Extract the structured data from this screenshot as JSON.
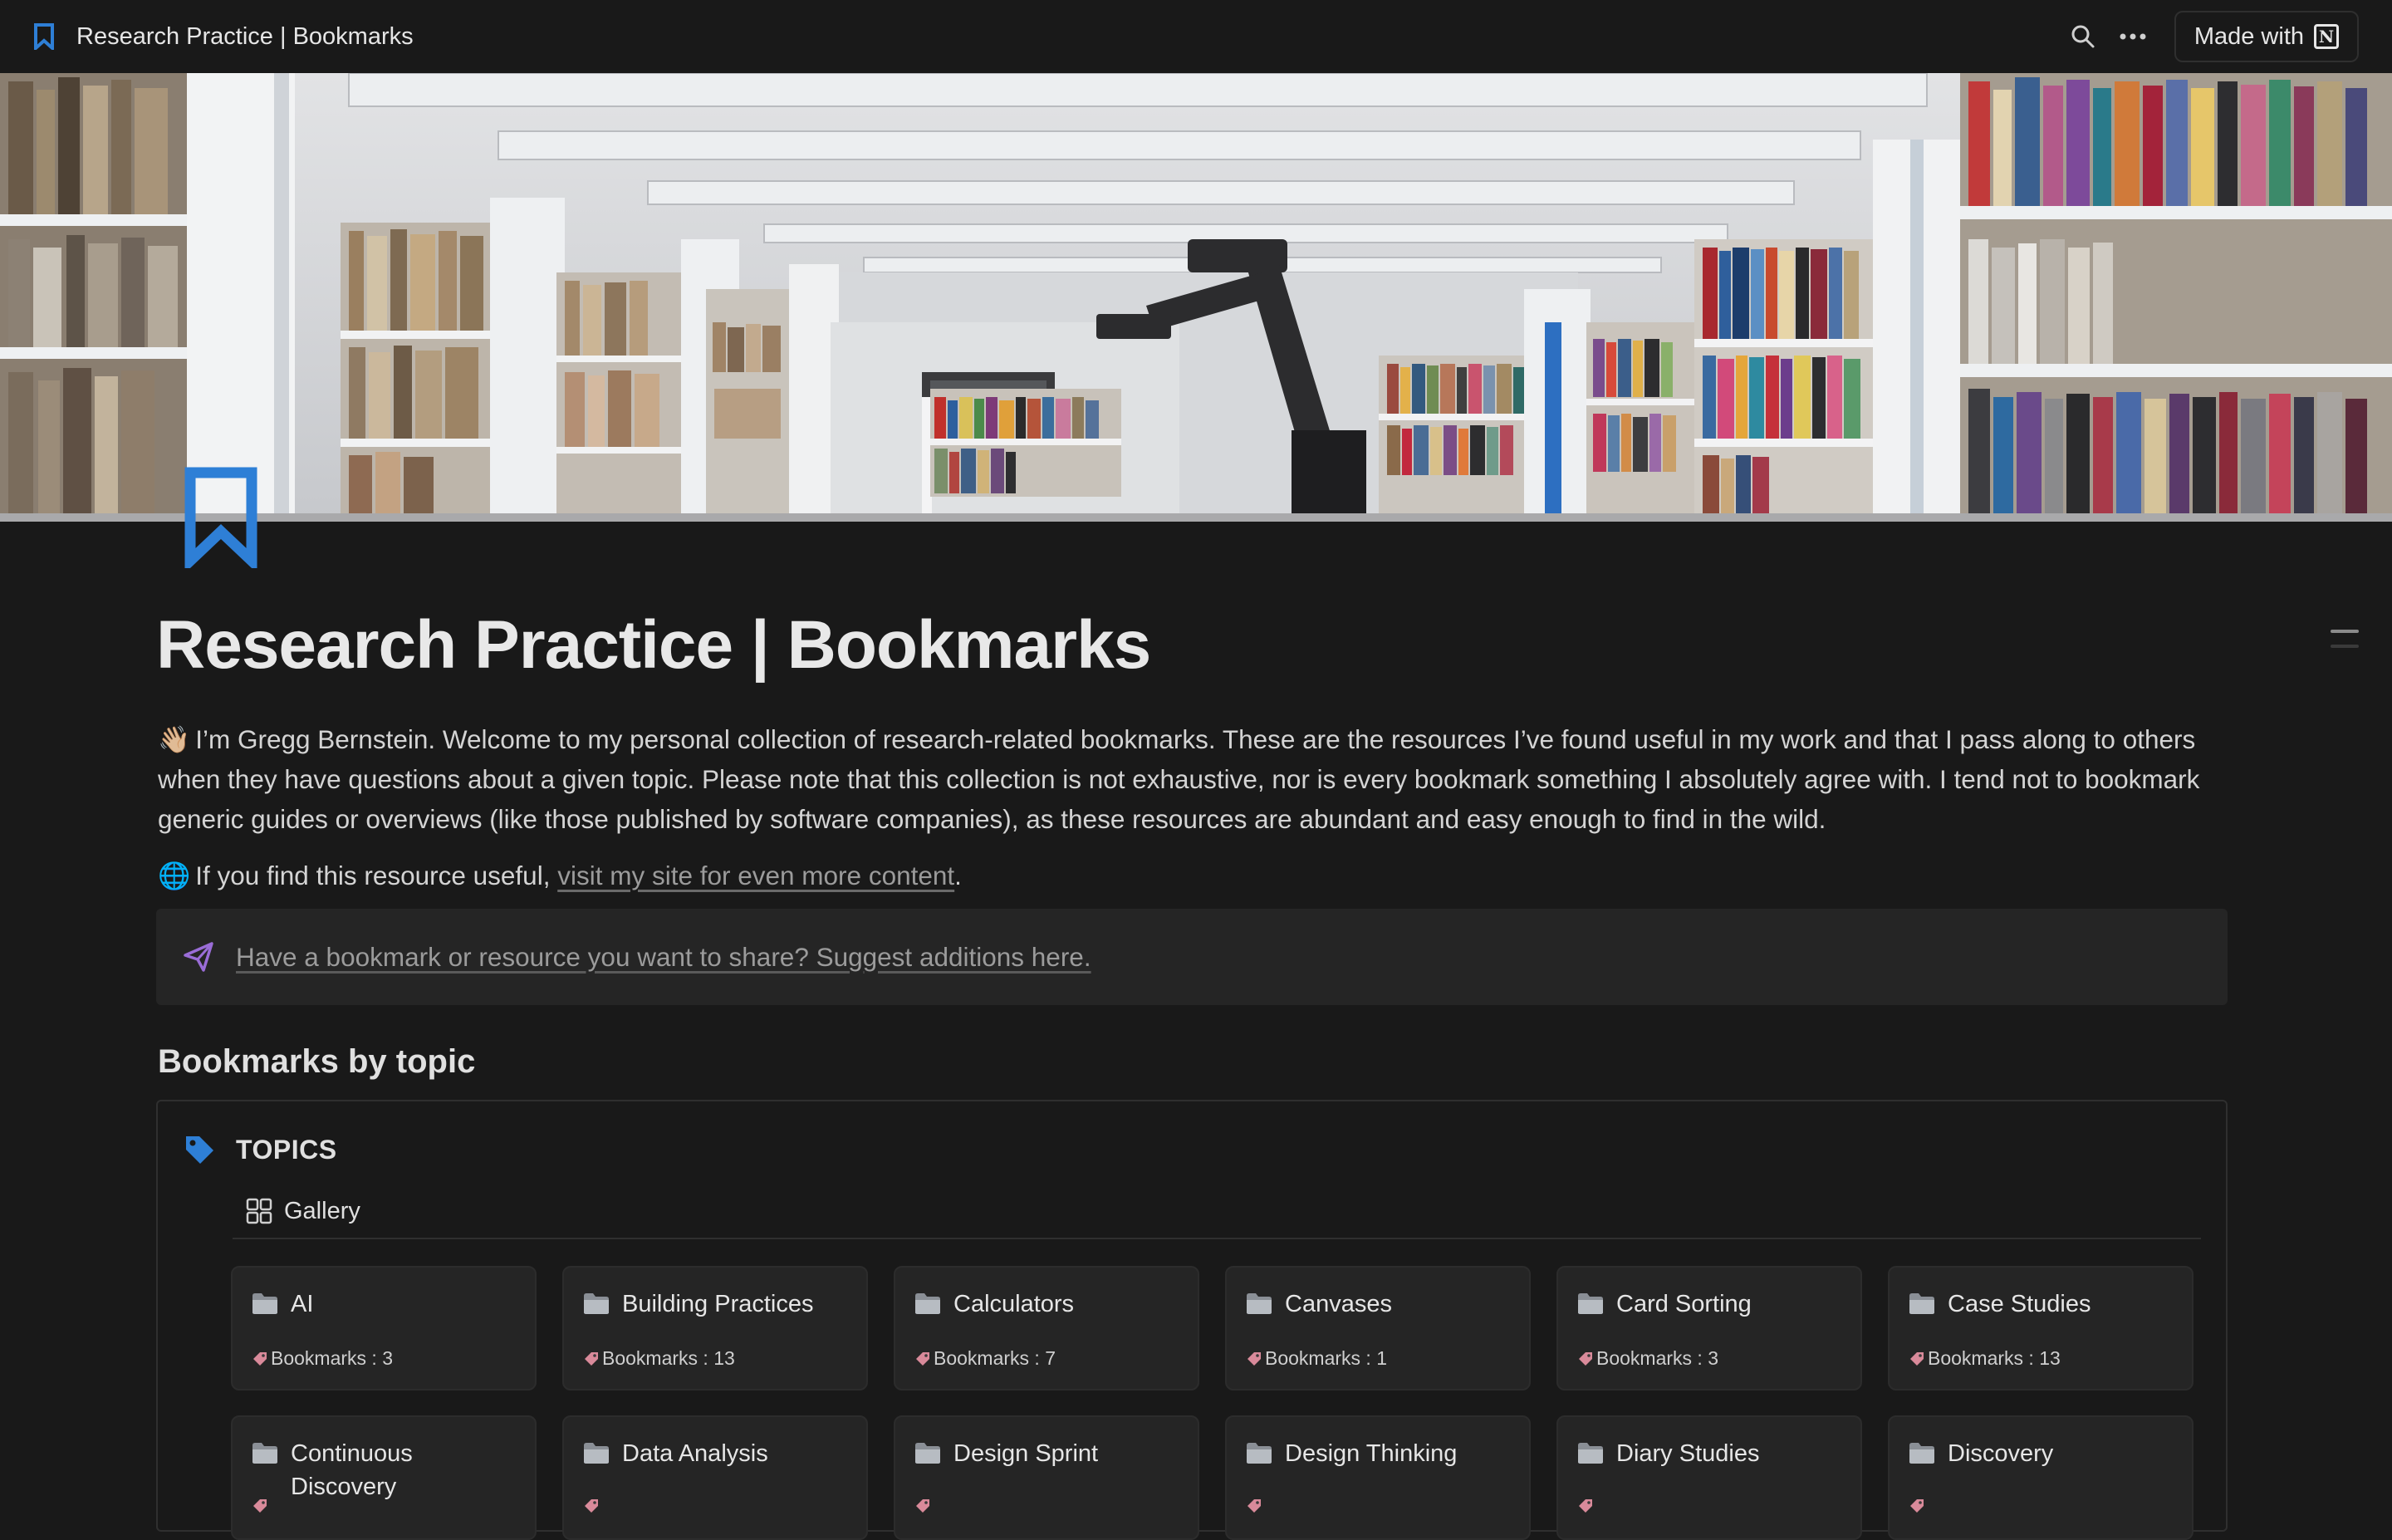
{
  "topbar": {
    "title": "Research Practice | Bookmarks",
    "made_with_label": "Made with"
  },
  "page": {
    "title": "Research Practice | Bookmarks",
    "intro_emoji": "👋🏼",
    "intro_text": "I’m Gregg Bernstein. Welcome to my personal collection of research-related bookmarks. These are the resources I’ve found useful in my work and that I pass along to others when they have questions about a given topic. Please note that this collection is not exhaustive, nor is every bookmark something I absolutely agree with. I tend not to bookmark generic guides or overviews (like those published by software companies), as these resources are abundant and easy enough to find in the wild.",
    "site_emoji": "🌐",
    "site_prefix": "If you find this resource useful,",
    "site_link": "visit my site for even more content",
    "site_suffix": ".",
    "callout_text": "Have a bookmark or resource you want to share? Suggest additions here.",
    "section_heading": "Bookmarks by topic"
  },
  "database": {
    "title": "TOPICS",
    "view_label": "Gallery",
    "cards": [
      {
        "name": "AI",
        "meta": "Bookmarks : 3"
      },
      {
        "name": "Building Practices",
        "meta": "Bookmarks : 13"
      },
      {
        "name": "Calculators",
        "meta": "Bookmarks : 7"
      },
      {
        "name": "Canvases",
        "meta": "Bookmarks : 1"
      },
      {
        "name": "Card Sorting",
        "meta": "Bookmarks : 3"
      },
      {
        "name": "Case Studies",
        "meta": "Bookmarks : 13"
      },
      {
        "name": "Continuous Discovery",
        "meta": ""
      },
      {
        "name": "Data Analysis",
        "meta": ""
      },
      {
        "name": "Design Sprint",
        "meta": ""
      },
      {
        "name": "Design Thinking",
        "meta": ""
      },
      {
        "name": "Diary Studies",
        "meta": ""
      },
      {
        "name": "Discovery",
        "meta": ""
      }
    ]
  },
  "colors": {
    "background": "#191919",
    "accent_blue": "#2e7fd6",
    "callout_icon": "#9a6dd7"
  },
  "icons": {
    "page_icon": "bookmark-icon",
    "search": "search-icon",
    "more": "more-icon",
    "notion": "notion-logo-icon",
    "database": "tag-icon",
    "view": "gallery-icon",
    "card": "folder-icon",
    "callout": "paper-plane-icon"
  }
}
